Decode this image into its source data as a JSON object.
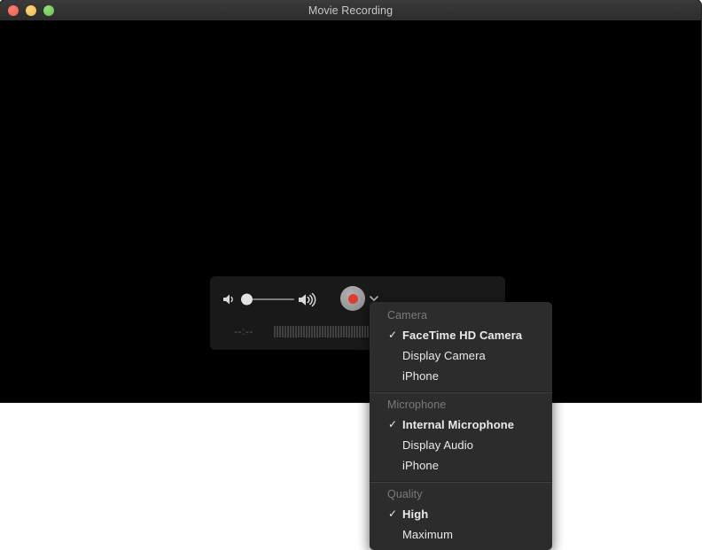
{
  "window": {
    "title": "Movie Recording",
    "traffic_lights": [
      {
        "name": "close",
        "color": "#eb5f53"
      },
      {
        "name": "minimize",
        "color": "#e8c04e"
      },
      {
        "name": "zoom",
        "color": "#6cc24a"
      }
    ],
    "video_background": "#000000"
  },
  "controls": {
    "volume_low_icon": "speaker-low-icon",
    "volume_high_icon": "speaker-high-icon",
    "volume_value": 0,
    "record_button_label": "Record",
    "record_dot_color": "#e23b2e",
    "chevron_icon": "chevron-down-icon",
    "timecode": "--:--",
    "meter_tick_count": 58
  },
  "menu": {
    "sections": [
      {
        "title": "Camera",
        "items": [
          {
            "label": "FaceTime HD Camera",
            "checked": true
          },
          {
            "label": "Display Camera",
            "checked": false
          },
          {
            "label": "iPhone",
            "checked": false
          }
        ]
      },
      {
        "title": "Microphone",
        "items": [
          {
            "label": "Internal Microphone",
            "checked": true
          },
          {
            "label": "Display Audio",
            "checked": false
          },
          {
            "label": "iPhone",
            "checked": false
          }
        ]
      },
      {
        "title": "Quality",
        "items": [
          {
            "label": "High",
            "checked": true
          },
          {
            "label": "Maximum",
            "checked": false
          }
        ]
      }
    ],
    "check_glyph": "✓"
  }
}
